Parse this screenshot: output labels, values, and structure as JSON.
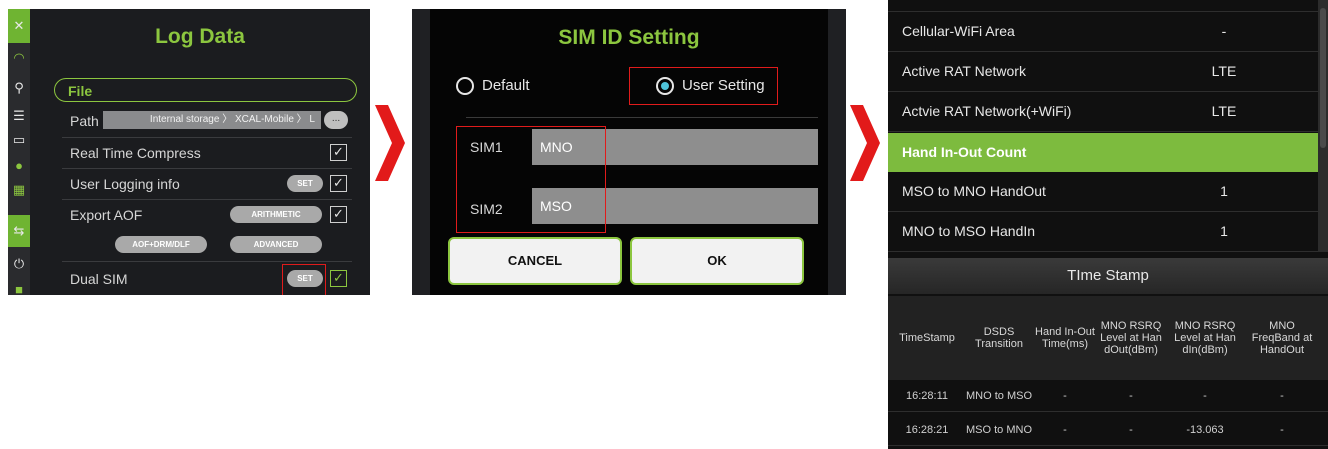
{
  "log_panel": {
    "title": "Log Data",
    "file_label": "File",
    "path_label": "Path",
    "path_value": "Internal storage 〉 XCAL-Mobile 〉 L",
    "path_browse": "...",
    "real_time_compress": "Real Time Compress",
    "user_logging_info": "User Logging info",
    "user_logging_set": "SET",
    "export_aof": "Export AOF",
    "arithmetic": "ARITHMETIC",
    "aof_drm_dlf": "AOF+DRM/DLF",
    "advanced": "ADVANCED",
    "dual_sim": "Dual SIM",
    "dual_sim_set": "SET",
    "checkbox_mark": "✓",
    "highlight_color": "#e01b1b",
    "accent_color": "#8cc63f"
  },
  "sim_panel": {
    "title": "SIM ID Setting",
    "default_label": "Default",
    "user_setting_label": "User Setting",
    "sim1_label": "SIM1",
    "sim1_value": "MNO",
    "sim2_label": "SIM2",
    "sim2_value": "MSO",
    "cancel": "CANCEL",
    "ok": "OK"
  },
  "table_panel": {
    "rows": [
      {
        "label": "Cellular-WiFi Area",
        "value": "-"
      },
      {
        "label": "Active RAT Network",
        "value": "LTE"
      },
      {
        "label": "Actvie RAT Network(+WiFi)",
        "value": "LTE"
      }
    ],
    "section": "Hand In-Out Count",
    "counts": [
      {
        "label": "MSO to MNO HandOut",
        "value": "1"
      },
      {
        "label": "MNO to MSO HandIn",
        "value": "1"
      }
    ],
    "timestamp_title": "TIme Stamp",
    "columns": [
      "TimeStamp",
      "DSDS Transition",
      "Hand In-Out Time(ms)",
      "MNO RSRQ Level at Han dOut(dBm)",
      "MNO RSRQ Level at Han dIn(dBm)",
      "MNO FreqBand at HandOut"
    ],
    "data": [
      [
        "16:28:11",
        "MNO to MSO",
        "-",
        "-",
        "-",
        "-"
      ],
      [
        "16:28:21",
        "MSO to MNO",
        "-",
        "-",
        "-13.063",
        "-"
      ]
    ]
  }
}
